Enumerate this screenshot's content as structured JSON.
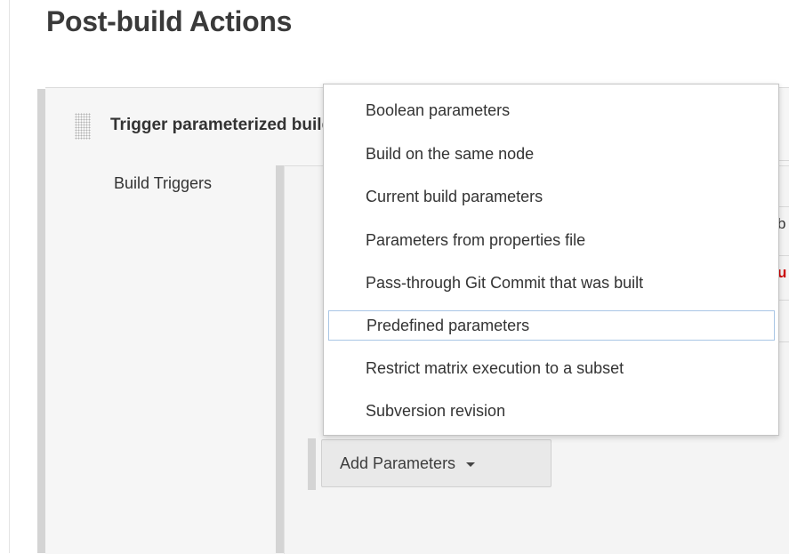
{
  "page": {
    "title": "Post-build Actions"
  },
  "section": {
    "heading": "Trigger parameterized build on other projects"
  },
  "inner": {
    "label": "Build Triggers"
  },
  "peek": {
    "glyph1": "b",
    "glyph2": "u",
    "glyph2_color": "#cc0000"
  },
  "add_button": {
    "label": "Add Parameters"
  },
  "menu": {
    "items": [
      {
        "label": "Boolean parameters"
      },
      {
        "label": "Build on the same node"
      },
      {
        "label": "Current build parameters"
      },
      {
        "label": "Parameters from properties file"
      },
      {
        "label": "Pass-through Git Commit that was built"
      },
      {
        "label": "Predefined parameters",
        "selected": true
      },
      {
        "label": "Restrict matrix execution to a subset"
      },
      {
        "label": "Subversion revision"
      }
    ]
  }
}
